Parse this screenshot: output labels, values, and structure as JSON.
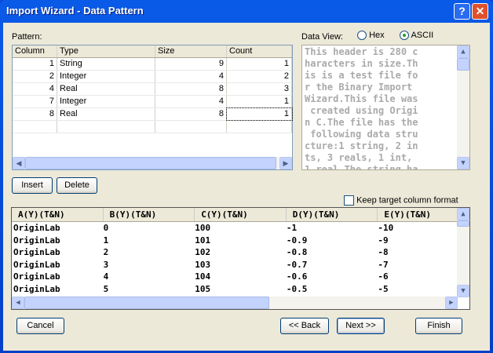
{
  "window": {
    "title": "Import Wizard - Data Pattern",
    "help": "?",
    "close": "✕"
  },
  "pattern": {
    "label": "Pattern:",
    "columns": [
      "Column",
      "Type",
      "Size",
      "Count"
    ],
    "rows": [
      [
        "1",
        "String",
        "9",
        "1"
      ],
      [
        "2",
        "Integer",
        "4",
        "2"
      ],
      [
        "4",
        "Real",
        "8",
        "3"
      ],
      [
        "7",
        "Integer",
        "4",
        "1"
      ],
      [
        "8",
        "Real",
        "8",
        "1"
      ]
    ]
  },
  "data_view": {
    "label": "Data View:",
    "hex": "Hex",
    "ascii": "ASCII",
    "selected": "ASCII",
    "lines": [
      "This header is 280 c",
      "haracters in size.Th",
      "is is a test file fo",
      "r the Binary Import ",
      "Wizard.This file was",
      " created using Origi",
      "n C.The file has the",
      " following data stru",
      "cture:1 string, 2 in",
      "ts, 3 reals, 1 int, ",
      "1 real.The string ha"
    ]
  },
  "buttons": {
    "insert": "Insert",
    "delete": "Delete",
    "cancel": "Cancel",
    "back": "<< Back",
    "next": "Next >>",
    "finish": "Finish"
  },
  "keep_format": {
    "label": "Keep target column format",
    "checked": false
  },
  "preview": {
    "columns": [
      "A(Y)(T&N)",
      "B(Y)(T&N)",
      "C(Y)(T&N)",
      "D(Y)(T&N)",
      "E(Y)(T&N)"
    ],
    "rows": [
      [
        "OriginLab",
        "0",
        "100",
        "-1",
        "-10"
      ],
      [
        "OriginLab",
        "1",
        "101",
        "-0.9",
        "-9"
      ],
      [
        "OriginLab",
        "2",
        "102",
        "-0.8",
        "-8"
      ],
      [
        "OriginLab",
        "3",
        "103",
        "-0.7",
        "-7"
      ],
      [
        "OriginLab",
        "4",
        "104",
        "-0.6",
        "-6"
      ],
      [
        "OriginLab",
        "5",
        "105",
        "-0.5",
        "-5"
      ]
    ]
  }
}
